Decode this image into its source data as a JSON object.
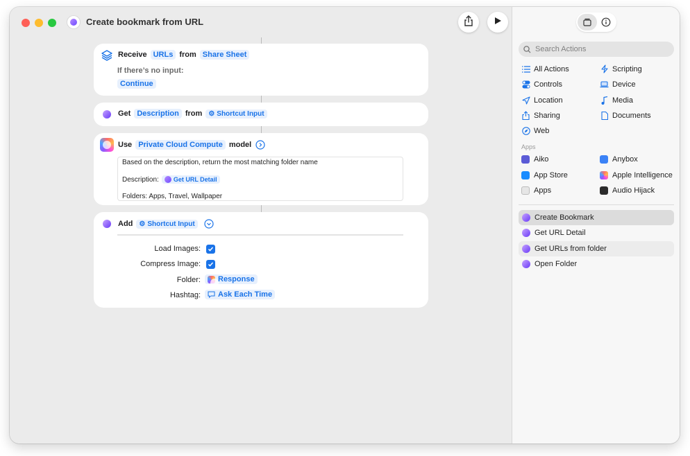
{
  "window": {
    "title": "Create bookmark from URL"
  },
  "toolbar": {
    "share_icon": "share-icon",
    "run_icon": "play-icon"
  },
  "actions": {
    "receive": {
      "verb": "Receive",
      "types": "URLs",
      "from_word": "from",
      "source": "Share Sheet",
      "no_input_label": "If there’s no input:",
      "no_input_value": "Continue"
    },
    "get": {
      "verb": "Get",
      "property": "Description",
      "from_word": "from",
      "source": "Shortcut Input"
    },
    "use": {
      "verb": "Use",
      "model": "Private Cloud Compute",
      "model_word": "model",
      "prompt_line1": "Based on the description, return the most matching folder name",
      "prompt_desc_label": "Description:",
      "prompt_desc_var": "Get URL Detail",
      "prompt_folders": "Folders: Apps, Travel, Wallpaper"
    },
    "add": {
      "verb": "Add",
      "input": "Shortcut Input",
      "params": [
        {
          "label": "Load Images:",
          "checked": true
        },
        {
          "label": "Compress Image:",
          "checked": true
        },
        {
          "label": "Folder:",
          "value": "Response"
        },
        {
          "label": "Hashtag:",
          "value": "Ask Each Time"
        }
      ]
    }
  },
  "sidebar": {
    "search_placeholder": "Search Actions",
    "categories": [
      {
        "label": "All Actions",
        "icon": "list-icon"
      },
      {
        "label": "Scripting",
        "icon": "scripting-icon"
      },
      {
        "label": "Controls",
        "icon": "controls-icon"
      },
      {
        "label": "Device",
        "icon": "laptop-icon"
      },
      {
        "label": "Location",
        "icon": "location-arrow-icon"
      },
      {
        "label": "Media",
        "icon": "music-note-icon"
      },
      {
        "label": "Sharing",
        "icon": "share-icon"
      },
      {
        "label": "Documents",
        "icon": "document-icon"
      },
      {
        "label": "Web",
        "icon": "compass-icon"
      }
    ],
    "apps_heading": "Apps",
    "apps": [
      {
        "label": "Aiko",
        "color": "#5b5bd6"
      },
      {
        "label": "Anybox",
        "color": "#3b82f6"
      },
      {
        "label": "App Store",
        "color": "#1a8cff"
      },
      {
        "label": "Apple Intelligence",
        "color": "#ff6fb5"
      },
      {
        "label": "Apps",
        "color": "#9a9a9a"
      },
      {
        "label": "Audio Hijack",
        "color": "#2b2b2b"
      }
    ],
    "shortcuts": [
      "Create Bookmark",
      "Get URL Detail",
      "Get URLs from folder",
      "Open Folder"
    ]
  },
  "colors": {
    "accent": "#1a73e8",
    "token_bg": "#e7f0fd"
  }
}
